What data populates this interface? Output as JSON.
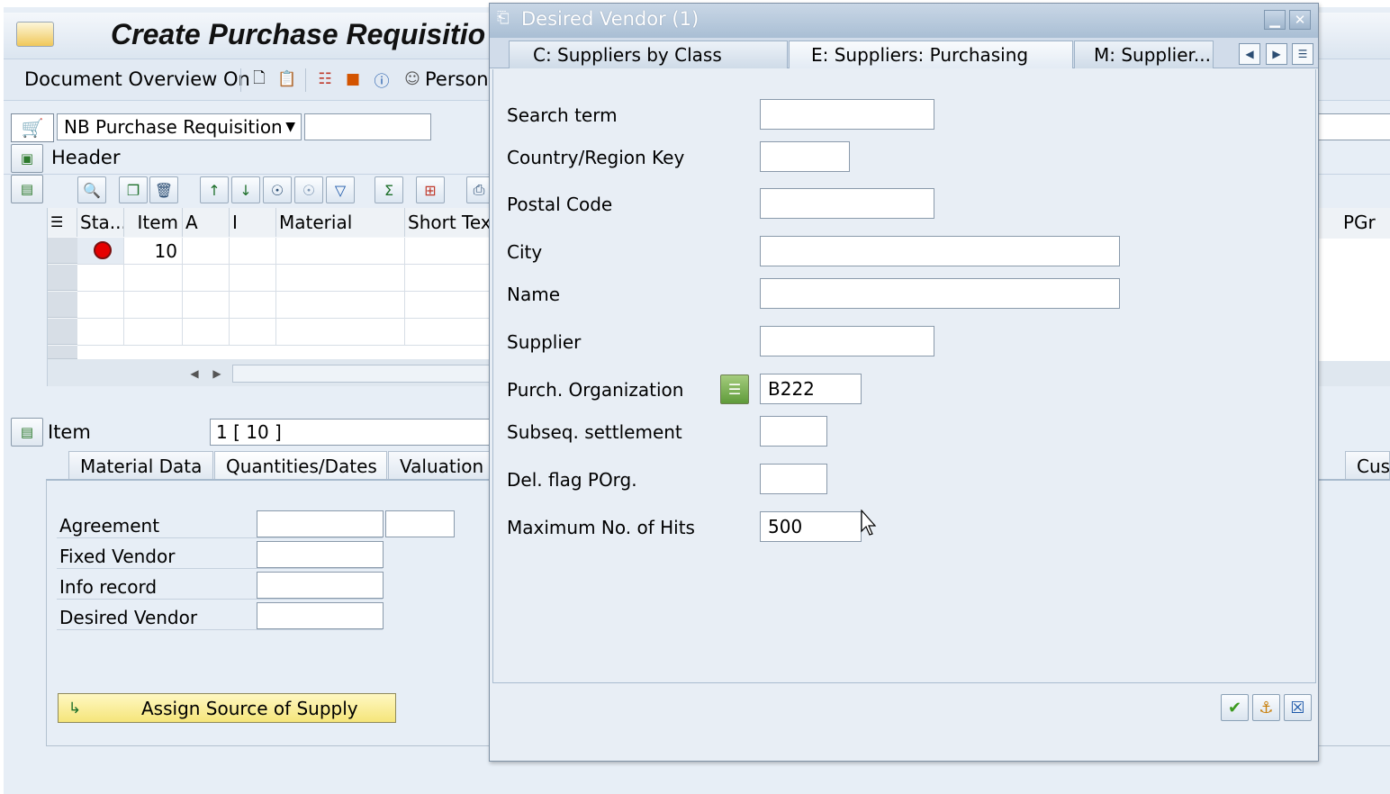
{
  "app": {
    "title": "Create Purchase Requisitio",
    "toolbar": {
      "document_overview": "Document Overview On",
      "personal": "Persona"
    },
    "doc_type": "NB Purchase Requisition",
    "header_label": "Header",
    "table": {
      "columns": [
        "Sta...",
        "Item",
        "A",
        "I",
        "Material",
        "Short Tex"
      ],
      "right_column": "PGr",
      "rows": [
        {
          "status": "red-dot",
          "item": "10"
        }
      ]
    },
    "item": {
      "label": "Item",
      "value": "1 [ 10 ]"
    },
    "tabs": [
      "Material Data",
      "Quantities/Dates",
      "Valuation"
    ],
    "tab_right": "Cust",
    "fields": {
      "agreement": "Agreement",
      "fixed_vendor": "Fixed Vendor",
      "info_record": "Info record",
      "desired_vendor": "Desired Vendor"
    },
    "assign_button": "Assign Source of Supply"
  },
  "dialog": {
    "title": "Desired Vendor (1)",
    "tabs": [
      {
        "label": "C: Suppliers by Class",
        "active": false
      },
      {
        "label": "E: Suppliers: Purchasing",
        "active": true
      },
      {
        "label": "M: Supplier...",
        "active": false
      }
    ],
    "fields": {
      "search_term": {
        "label": "Search term",
        "value": ""
      },
      "country": {
        "label": "Country/Region Key",
        "value": ""
      },
      "postal_code": {
        "label": "Postal Code",
        "value": ""
      },
      "city": {
        "label": "City",
        "value": ""
      },
      "name": {
        "label": "Name",
        "value": ""
      },
      "supplier": {
        "label": "Supplier",
        "value": ""
      },
      "purch_org": {
        "label": "Purch. Organization",
        "value": "B222"
      },
      "subseq": {
        "label": "Subseq. settlement",
        "value": ""
      },
      "del_flag": {
        "label": "Del. flag POrg.",
        "value": ""
      },
      "max_hits": {
        "label": "Maximum No. of Hits",
        "value": "500"
      }
    }
  },
  "colors": {
    "accent": "#a9bed4",
    "status_red": "#e60000",
    "confirm_green": "#3c9a1f",
    "button_yellow": "#f5e57a"
  }
}
